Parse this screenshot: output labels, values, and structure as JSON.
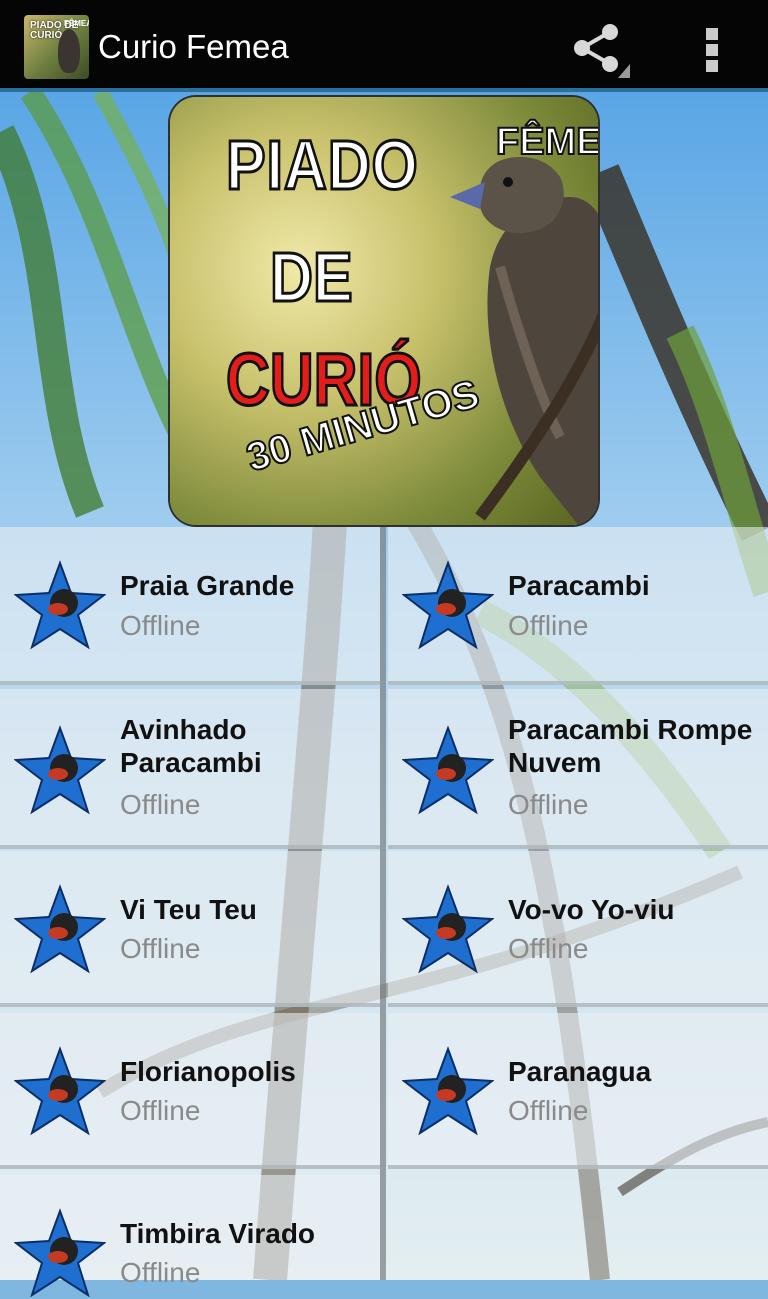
{
  "actionbar": {
    "title": "Curio Femea",
    "app_icon": {
      "text_top": "PIADO DE CURIÓ",
      "text_side": "FÊMEA"
    },
    "share_icon": "share-icon",
    "overflow_icon": "overflow-menu-icon"
  },
  "banner": {
    "line1": "PIADO",
    "line2": "DE",
    "line3": "CURIÓ",
    "badge": "FÊMEA",
    "footer": "30 MINUTOS"
  },
  "items": [
    {
      "name": "Praia Grande",
      "status": "Offline"
    },
    {
      "name": "Paracambi",
      "status": "Offline"
    },
    {
      "name": "Avinhado Paracambi",
      "status": "Offline"
    },
    {
      "name": "Paracambi Rompe Nuvem",
      "status": "Offline"
    },
    {
      "name": "Vi Teu Teu",
      "status": "Offline"
    },
    {
      "name": "Vo-vo Yo-viu",
      "status": "Offline"
    },
    {
      "name": "Florianopolis",
      "status": "Offline"
    },
    {
      "name": "Paranagua",
      "status": "Offline"
    },
    {
      "name": "Timbira Virado",
      "status": "Offline"
    }
  ],
  "colors": {
    "actionbar": "#050505",
    "accent": "#2b6f9c",
    "status_text": "#8a8a8a"
  }
}
